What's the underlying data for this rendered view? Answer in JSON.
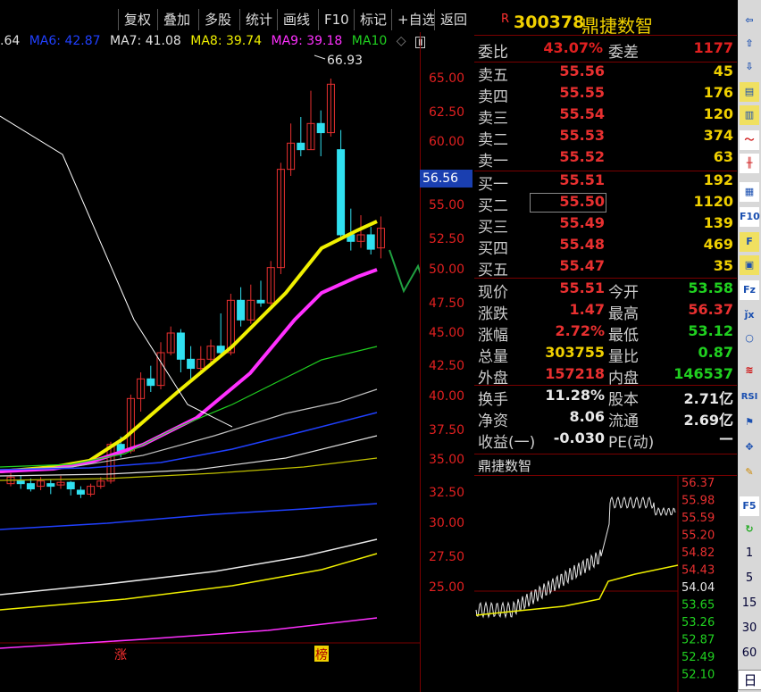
{
  "toolbar": {
    "buttons": [
      "复权",
      "叠加",
      "多股",
      "统计",
      "画线",
      "F10",
      "标记",
      "+自选",
      "返回"
    ]
  },
  "ma_legend": [
    {
      "label": ".64",
      "color": "#e0e0e0"
    },
    {
      "label": "MA6: 42.87",
      "color": "#2040ff"
    },
    {
      "label": "MA7: 41.08",
      "color": "#e0e0e0"
    },
    {
      "label": "MA8: 39.74",
      "color": "#f0f000"
    },
    {
      "label": "MA9: 39.18",
      "color": "#ff30ff"
    },
    {
      "label": "MA10",
      "color": "#20d020"
    }
  ],
  "price_axis": [
    "65.00",
    "62.50",
    "60.00",
    "57.50",
    "55.00",
    "52.50",
    "50.00",
    "47.50",
    "45.00",
    "42.50",
    "40.00",
    "37.50",
    "35.00",
    "32.50",
    "30.00",
    "27.50",
    "25.00"
  ],
  "current_price_tag": "56.56",
  "peak_label": "66.93",
  "markers": {
    "zhang": "涨",
    "bang": "榜"
  },
  "stock": {
    "code": "300378",
    "name": "鼎捷数智",
    "flag": "R"
  },
  "committee": {
    "ratio_label": "委比",
    "ratio": "43.07%",
    "diff_label": "委差",
    "diff": "1177"
  },
  "asks": [
    {
      "label": "卖五",
      "price": "55.56",
      "vol": "45"
    },
    {
      "label": "卖四",
      "price": "55.55",
      "vol": "176"
    },
    {
      "label": "卖三",
      "price": "55.54",
      "vol": "120"
    },
    {
      "label": "卖二",
      "price": "55.53",
      "vol": "374"
    },
    {
      "label": "卖一",
      "price": "55.52",
      "vol": "63"
    }
  ],
  "bids": [
    {
      "label": "买一",
      "price": "55.51",
      "vol": "192"
    },
    {
      "label": "买二",
      "price": "55.50",
      "vol": "1120"
    },
    {
      "label": "买三",
      "price": "55.49",
      "vol": "139"
    },
    {
      "label": "买四",
      "price": "55.48",
      "vol": "469"
    },
    {
      "label": "买五",
      "price": "55.47",
      "vol": "35"
    }
  ],
  "stats": [
    {
      "l1": "现价",
      "v1": "55.51",
      "c1": "red",
      "l2": "今开",
      "v2": "53.58",
      "c2": "green"
    },
    {
      "l1": "涨跌",
      "v1": "1.47",
      "c1": "red",
      "l2": "最高",
      "v2": "56.37",
      "c2": "red"
    },
    {
      "l1": "涨幅",
      "v1": "2.72%",
      "c1": "red",
      "l2": "最低",
      "v2": "53.12",
      "c2": "green"
    },
    {
      "l1": "总量",
      "v1": "303755",
      "c1": "yellow",
      "l2": "量比",
      "v2": "0.87",
      "c2": "green"
    },
    {
      "l1": "外盘",
      "v1": "157218",
      "c1": "red",
      "l2": "内盘",
      "v2": "146537",
      "c2": "green"
    }
  ],
  "stats2": [
    {
      "l1": "换手",
      "v1": "11.28%",
      "l2": "股本",
      "v2": "2.71亿"
    },
    {
      "l1": "净资",
      "v1": "8.06",
      "l2": "流通",
      "v2": "2.69亿"
    },
    {
      "l1": "收益(一)",
      "v1": "-0.030",
      "l2": "PE(动)",
      "v2": "—"
    }
  ],
  "mini_chart": {
    "title": "鼎捷数智",
    "axis": [
      "56.37",
      "55.98",
      "55.59",
      "55.20",
      "54.82",
      "54.43",
      "54.04",
      "53.65",
      "53.26",
      "52.87",
      "52.49",
      "52.10"
    ]
  },
  "sidebar_numbers": [
    "1",
    "5",
    "15",
    "30",
    "60",
    "日"
  ]
}
